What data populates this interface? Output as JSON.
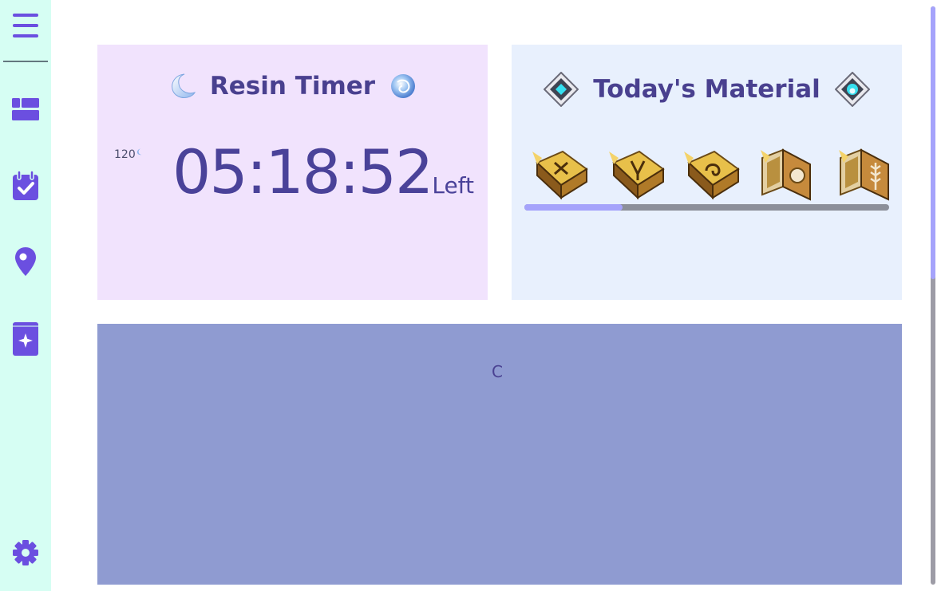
{
  "sidebar": {
    "items": [
      {
        "icon": "dashboard-icon"
      },
      {
        "icon": "calendar-check-icon"
      },
      {
        "icon": "map-pin-icon"
      },
      {
        "icon": "sparkle-book-icon"
      }
    ],
    "settings_icon": "gear-icon"
  },
  "resin": {
    "title": "Resin Timer",
    "count": "120",
    "timer": "05:18:52",
    "suffix": "Left"
  },
  "material": {
    "title": "Today's Material",
    "items": [
      "book-icon",
      "book-icon",
      "book-icon",
      "book-icon",
      "book-icon"
    ],
    "scroll_fraction": 0.27
  },
  "bottom": {
    "text": "C"
  },
  "colors": {
    "accent": "#6b4fe0",
    "title": "#49408f",
    "sidebar_bg": "#d6fef3",
    "resin_bg": "#f1e3fd",
    "material_bg": "#e8f0fd",
    "bottom_bg": "#8f9bd1"
  }
}
